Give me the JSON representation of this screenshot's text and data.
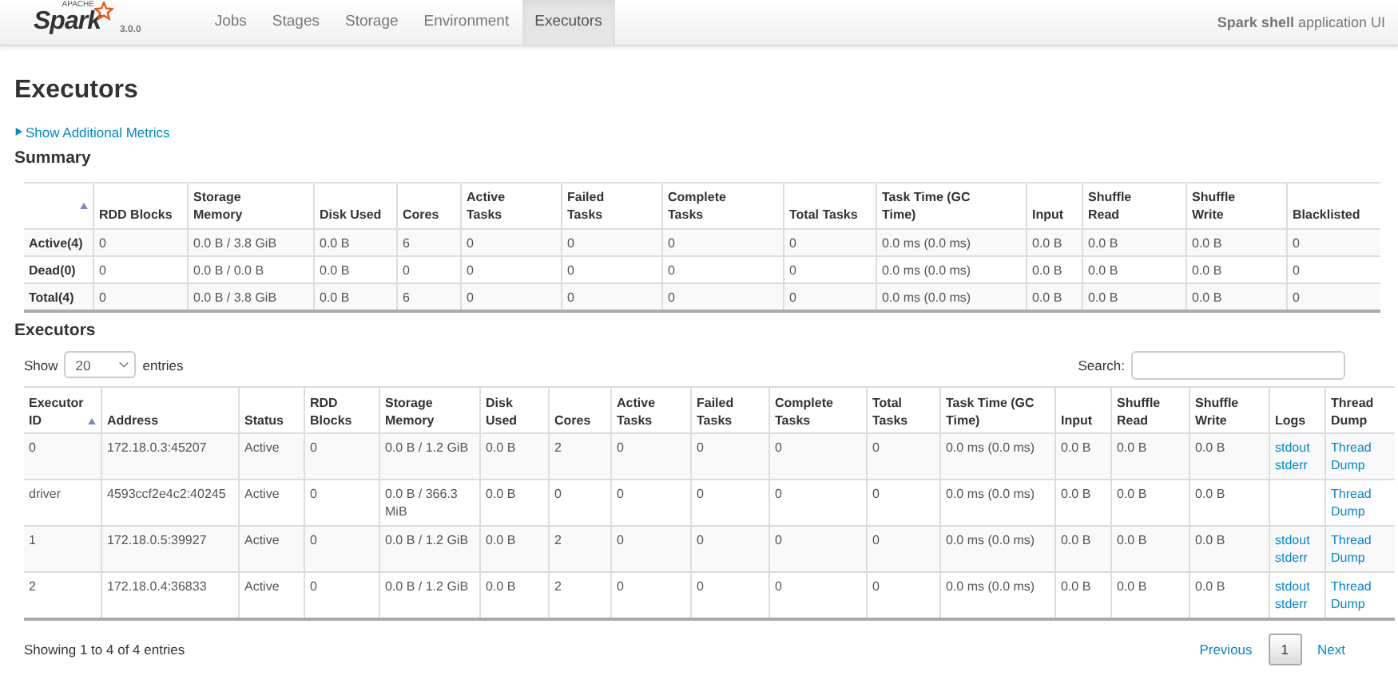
{
  "navbar": {
    "logo": {
      "top": "APACHE",
      "name": "Spark",
      "version": "3.0.0"
    },
    "tabs": [
      {
        "label": "Jobs",
        "selected": false
      },
      {
        "label": "Stages",
        "selected": false
      },
      {
        "label": "Storage",
        "selected": false
      },
      {
        "label": "Environment",
        "selected": false
      },
      {
        "label": "Executors",
        "selected": true
      }
    ],
    "app_name": "**Spark shell** application UI"
  },
  "page_title": "Executors",
  "additional_metrics": {
    "label": "Show Additional Metrics",
    "expanded": false
  },
  "summary": {
    "title": "Summary",
    "columns": [
      "",
      "RDD Blocks",
      "Storage Memory",
      "Disk Used",
      "Cores",
      "Active Tasks",
      "Failed Tasks",
      "Complete Tasks",
      "Total Tasks",
      "Task Time (GC Time)",
      "Input",
      "Shuffle Read",
      "Shuffle Write",
      "Blacklisted"
    ],
    "rows": [
      [
        "Active(4)",
        "0",
        "0.0 B / 3.8 GiB",
        "0.0 B",
        "6",
        "0",
        "0",
        "0",
        "0",
        "0.0 ms (0.0 ms)",
        "0.0 B",
        "0.0 B",
        "0.0 B",
        "0"
      ],
      [
        "Dead(0)",
        "0",
        "0.0 B / 0.0 B",
        "0.0 B",
        "0",
        "0",
        "0",
        "0",
        "0",
        "0.0 ms (0.0 ms)",
        "0.0 B",
        "0.0 B",
        "0.0 B",
        "0"
      ],
      [
        "Total(4)",
        "0",
        "0.0 B / 3.8 GiB",
        "0.0 B",
        "6",
        "0",
        "0",
        "0",
        "0",
        "0.0 ms (0.0 ms)",
        "0.0 B",
        "0.0 B",
        "0.0 B",
        "0"
      ]
    ]
  },
  "executors": {
    "title": "Executors",
    "length_menu": {
      "before": "Show",
      "value": "20",
      "after": "entries"
    },
    "search": {
      "label": "Search:"
    },
    "columns": [
      "Executor ID",
      "Address",
      "Status",
      "RDD Blocks",
      "Storage Memory",
      "Disk Used",
      "Cores",
      "Active Tasks",
      "Failed Tasks",
      "Complete Tasks",
      "Total Tasks",
      "Task Time (GC Time)",
      "Input",
      "Shuffle Read",
      "Shuffle Write",
      "Logs",
      "Thread Dump"
    ],
    "rows": [
      {
        "cells": [
          "0",
          "172.18.0.3:45207",
          "Active",
          "0",
          "0.0 B / 1.2 GiB",
          "0.0 B",
          "2",
          "0",
          "0",
          "0",
          "0",
          "0.0 ms (0.0 ms)",
          "0.0 B",
          "0.0 B",
          "0.0 B"
        ],
        "logs": [
          "stdout",
          "stderr"
        ],
        "thread_dump": "Thread Dump"
      },
      {
        "cells": [
          "driver",
          "4593ccf2e4c2:40245",
          "Active",
          "0",
          "0.0 B / 366.3 MiB",
          "0.0 B",
          "0",
          "0",
          "0",
          "0",
          "0",
          "0.0 ms (0.0 ms)",
          "0.0 B",
          "0.0 B",
          "0.0 B"
        ],
        "thread_dump": "Thread Dump"
      },
      {
        "cells": [
          "1",
          "172.18.0.5:39927",
          "Active",
          "0",
          "0.0 B / 1.2 GiB",
          "0.0 B",
          "2",
          "0",
          "0",
          "0",
          "0",
          "0.0 ms (0.0 ms)",
          "0.0 B",
          "0.0 B",
          "0.0 B"
        ],
        "logs": [
          "stdout",
          "stderr"
        ],
        "thread_dump": "Thread Dump"
      },
      {
        "cells": [
          "2",
          "172.18.0.4:36833",
          "Active",
          "0",
          "0.0 B / 1.2 GiB",
          "0.0 B",
          "2",
          "0",
          "0",
          "0",
          "0",
          "0.0 ms (0.0 ms)",
          "0.0 B",
          "0.0 B",
          "0.0 B"
        ],
        "logs": [
          "stdout",
          "stderr"
        ],
        "thread_dump": "Thread Dump"
      }
    ],
    "info": "Showing 1 to 4 of 4 entries",
    "pagination": [
      {
        "kind": "link",
        "label": "Previous"
      },
      {
        "kind": "page",
        "label": "1",
        "selected": true
      },
      {
        "kind": "link",
        "label": "Next"
      }
    ]
  }
}
